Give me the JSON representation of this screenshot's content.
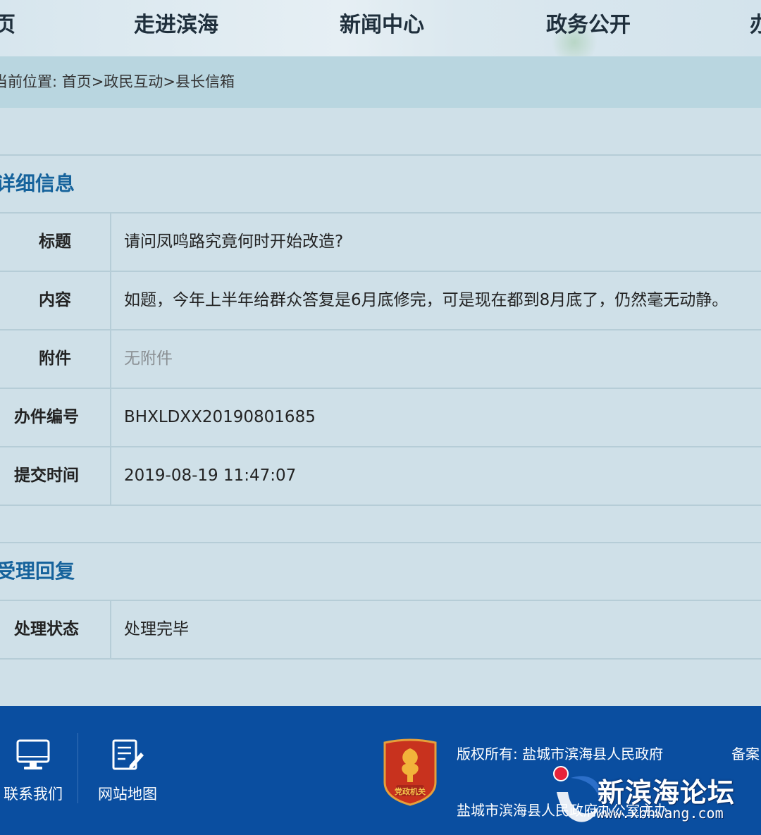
{
  "nav": {
    "items": [
      "页",
      "走进滨海",
      "新闻中心",
      "政务公开",
      "办"
    ]
  },
  "breadcrumb": "当前位置: 首页>政民互动>县长信箱",
  "detail": {
    "heading": "详细信息",
    "rows": [
      {
        "label": "标题",
        "value": "请问凤鸣路究竟何时开始改造?"
      },
      {
        "label": "内容",
        "value": "如题，今年上半年给群众答复是6月底修完，可是现在都到8月底了，仍然毫无动静。"
      },
      {
        "label": "附件",
        "value": "无附件"
      },
      {
        "label": "办件编号",
        "value": "BHXLDXX20190801685"
      },
      {
        "label": "提交时间",
        "value": "2019-08-19 11:47:07"
      }
    ]
  },
  "reply": {
    "heading": "受理回复",
    "rows": [
      {
        "label": "处理状态",
        "value": "处理完毕"
      }
    ]
  },
  "footer": {
    "contact_label": "联系我们",
    "sitemap_label": "网站地图",
    "emblem_text": "党政机关",
    "copyright": "版权所有: 盐城市滨海县人民政府",
    "beian": "备案",
    "host": "盐城市滨海县人民政府办公室主办",
    "icons": {
      "contact": "monitor-icon",
      "sitemap": "document-edit-icon"
    }
  },
  "watermark": {
    "title": "新滨海论坛",
    "url": "www.xbhwang.com"
  },
  "colors": {
    "background": "#cfe0e8",
    "breadcrumb_bg": "#b9d6e0",
    "section_heading": "#16639c",
    "footer_bg": "#0a4ea0",
    "emblem": "#c8321e"
  }
}
